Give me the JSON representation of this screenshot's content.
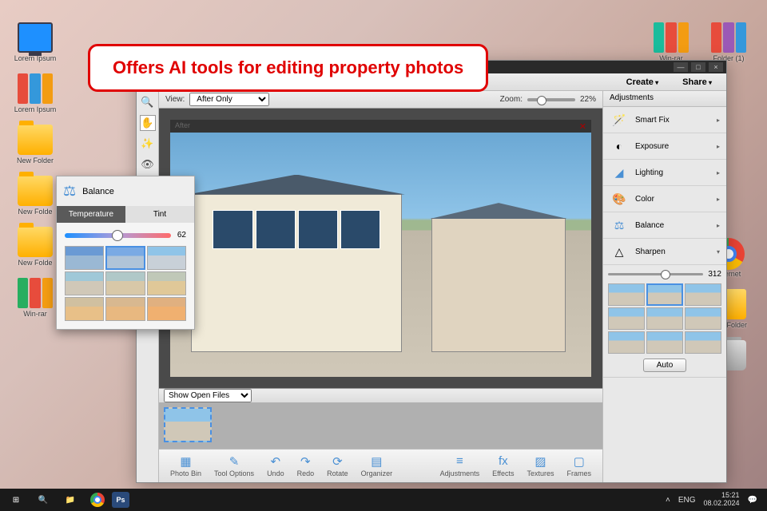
{
  "callout": {
    "text": "Offers AI tools for editing property photos"
  },
  "desktop_icons": {
    "pc": "Lorem Ipsum",
    "books": "Lorem Ipsum",
    "folder1": "New Folder",
    "folder2": "New Folde",
    "folder3": "New Folde",
    "winrar": "Win-rar",
    "winrar2": "Win-rar",
    "folder_r": "Folder (1)",
    "chrome": "Internet",
    "folder_r2": "New Folder"
  },
  "app": {
    "top_buttons": {
      "create": "Create",
      "share": "Share"
    },
    "viewbar": {
      "view_label": "View:",
      "view_options": [
        "After Only"
      ],
      "zoom_label": "Zoom:",
      "zoom_value": "22%"
    },
    "canvas": {
      "mode_label": "After"
    },
    "filmstrip": {
      "dropdown": "Show Open Files"
    },
    "bottom_buttons": {
      "photo_bin": "Photo Bin",
      "tool_options": "Tool Options",
      "undo": "Undo",
      "redo": "Redo",
      "rotate": "Rotate",
      "organizer": "Organizer",
      "adjustments": "Adjustments",
      "effects": "Effects",
      "textures": "Textures",
      "frames": "Frames"
    },
    "right_panel": {
      "header": "Adjustments",
      "items": {
        "smart_fix": "Smart Fix",
        "exposure": "Exposure",
        "lighting": "Lighting",
        "color": "Color",
        "balance": "Balance",
        "sharpen": "Sharpen"
      },
      "sharpen_value": "312",
      "auto": "Auto"
    }
  },
  "balance_popup": {
    "title": "Balance",
    "tabs": {
      "temperature": "Temperature",
      "tint": "Tint"
    },
    "slider_value": "62"
  },
  "taskbar": {
    "lang": "ENG",
    "time": "15:21",
    "date": "08.02.2024"
  }
}
